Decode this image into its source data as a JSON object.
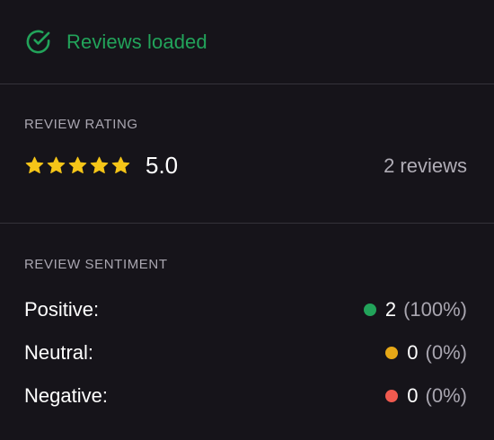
{
  "status": {
    "icon": "check-circle-icon",
    "text": "Reviews loaded",
    "color": "#22a35a"
  },
  "rating": {
    "label": "REVIEW RATING",
    "stars": 5,
    "star_color": "#f5c518",
    "value": "5.0",
    "count_text": "2 reviews"
  },
  "sentiment": {
    "label": "REVIEW SENTIMENT",
    "rows": [
      {
        "label": "Positive:",
        "count": "2",
        "percent": "(100%)",
        "color": "#22a35a"
      },
      {
        "label": "Neutral:",
        "count": "0",
        "percent": "(0%)",
        "color": "#e6a817"
      },
      {
        "label": "Negative:",
        "count": "0",
        "percent": "(0%)",
        "color": "#f05a4f"
      }
    ]
  }
}
